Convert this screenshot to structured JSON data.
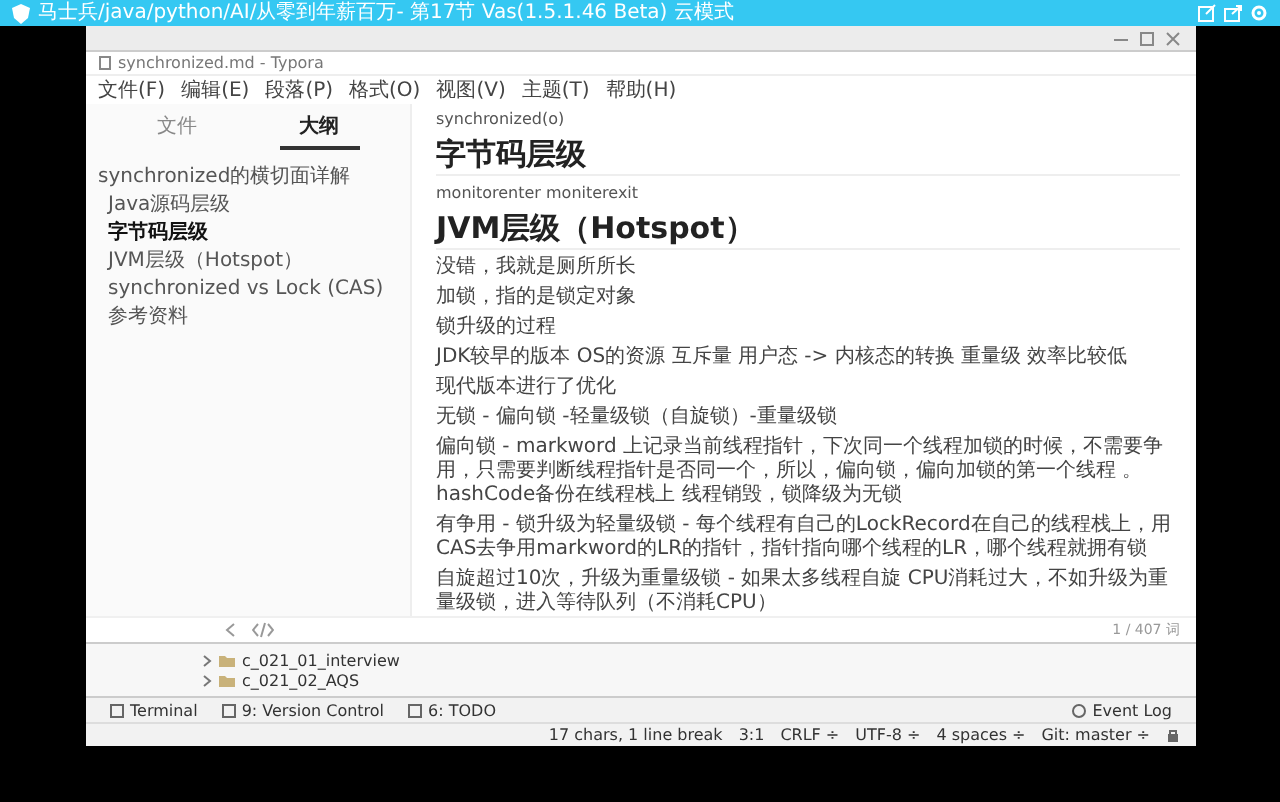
{
  "app_bar": {
    "title": "马士兵/java/python/AI/从零到年薪百万- 第17节 Vas(1.5.1.46 Beta) 云模式"
  },
  "typora": {
    "title": "synchronized.md - Typora",
    "menu": [
      "文件(F)",
      "编辑(E)",
      "段落(P)",
      "格式(O)",
      "视图(V)",
      "主题(T)",
      "帮助(H)"
    ],
    "sidebar": {
      "tabs": [
        {
          "label": "文件",
          "selected": false
        },
        {
          "label": "大纲",
          "selected": true
        }
      ],
      "outline": [
        {
          "label": "synchronized的横切面详解",
          "selected": false,
          "children": [
            {
              "label": "Java源码层级",
              "selected": false
            },
            {
              "label": "字节码层级",
              "selected": true
            },
            {
              "label": "JVM层级（Hotspot）",
              "selected": false
            },
            {
              "label": "synchronized vs Lock (CAS)",
              "selected": false
            },
            {
              "label": "参考资料",
              "selected": false
            }
          ]
        }
      ]
    },
    "document": {
      "blocks": [
        {
          "kind": "code",
          "text": "synchronized(o)"
        },
        {
          "kind": "heading",
          "text": "字节码层级"
        },
        {
          "kind": "code",
          "text": "monitorenter moniterexit"
        },
        {
          "kind": "heading",
          "text": "JVM层级（Hotspot）"
        },
        {
          "kind": "paragraph",
          "text": "没错，我就是厕所所长"
        },
        {
          "kind": "paragraph",
          "text": "加锁，指的是锁定对象"
        },
        {
          "kind": "paragraph",
          "text": "锁升级的过程"
        },
        {
          "kind": "paragraph",
          "text": "JDK较早的版本 OS的资源 互斥量 用户态 -> 内核态的转换 重量级 效率比较低"
        },
        {
          "kind": "paragraph",
          "text": "现代版本进行了优化"
        },
        {
          "kind": "paragraph",
          "text": "无锁 - 偏向锁 -轻量级锁（自旋锁）-重量级锁"
        },
        {
          "kind": "paragraph",
          "text": "偏向锁 - markword 上记录当前线程指针，下次同一个线程加锁的时候，不需要争用，只需要判断线程指针是否同一个，所以，偏向锁，偏向加锁的第一个线程 。hashCode备份在线程栈上 线程销毁，锁降级为无锁"
        },
        {
          "kind": "paragraph",
          "text": "有争用 - 锁升级为轻量级锁 - 每个线程有自己的LockRecord在自己的线程栈上，用CAS去争用markword的LR的指针，指针指向哪个线程的LR，哪个线程就拥有锁"
        },
        {
          "kind": "paragraph",
          "text": "自旋超过10次，升级为重量级锁 - 如果太多线程自旋 CPU消耗过大，不如升级为重量级锁，进入等待队列（不消耗CPU）"
        }
      ]
    },
    "word_count": "1 / 407 词"
  },
  "project_tree": {
    "items": [
      "c_021_01_interview",
      "c_021_02_AQS"
    ]
  },
  "tool_tabs": [
    "Terminal",
    "9: Version Control",
    "6: TODO"
  ],
  "event_log": "Event Log",
  "status_bar": {
    "items": [
      "17 chars, 1 line break",
      "3:1",
      "CRLF ÷",
      "UTF-8 ÷",
      "4 spaces ÷",
      "Git: master ÷"
    ]
  }
}
